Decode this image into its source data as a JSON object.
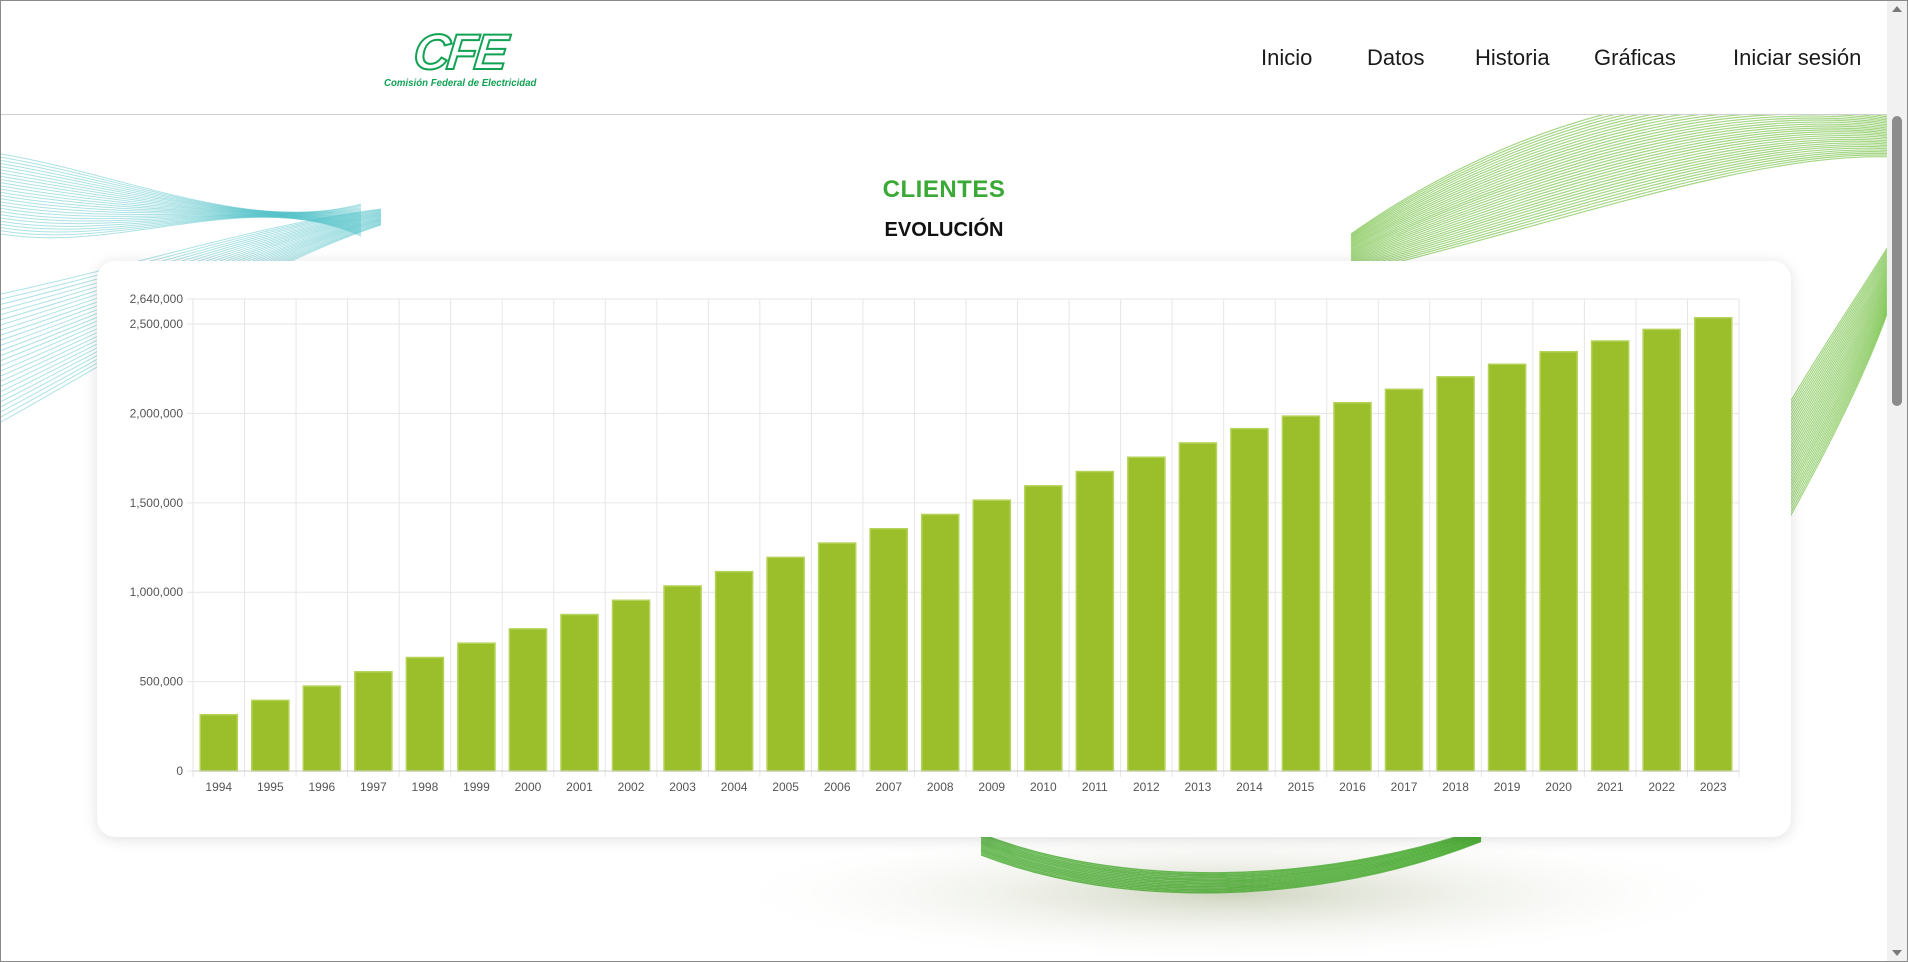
{
  "logo": {
    "mark": "CFE",
    "subtitle": "Comisión Federal de Electricidad"
  },
  "nav": {
    "items": [
      "Inicio",
      "Datos",
      "Historia",
      "Gráficas",
      "Iniciar sesión"
    ]
  },
  "page": {
    "title": "CLIENTES",
    "subtitle": "EVOLUCIÓN"
  },
  "colors": {
    "accent": "#3aa935",
    "bar": "#9bbf2a",
    "bar_border": "#b5d35a"
  },
  "chart_data": {
    "type": "bar",
    "categories": [
      "1994",
      "1995",
      "1996",
      "1997",
      "1998",
      "1999",
      "2000",
      "2001",
      "2002",
      "2003",
      "2004",
      "2005",
      "2006",
      "2007",
      "2008",
      "2009",
      "2010",
      "2011",
      "2012",
      "2013",
      "2014",
      "2015",
      "2016",
      "2017",
      "2018",
      "2019",
      "2020",
      "2021",
      "2022",
      "2023"
    ],
    "values": [
      315000,
      395000,
      475000,
      555000,
      635000,
      715000,
      795000,
      875000,
      955000,
      1035000,
      1115000,
      1195000,
      1275000,
      1355000,
      1435000,
      1515000,
      1595000,
      1675000,
      1755000,
      1835000,
      1915000,
      1985000,
      2060000,
      2135000,
      2205000,
      2275000,
      2345000,
      2405000,
      2470000,
      2535000
    ],
    "ylim": [
      0,
      2640000
    ],
    "yticks": [
      "0",
      "500,000",
      "1,000,000",
      "1,500,000",
      "2,000,000",
      "2,500,000",
      "2,640,000"
    ],
    "ytick_values": [
      0,
      500000,
      1000000,
      1500000,
      2000000,
      2500000,
      2640000
    ],
    "grid": true,
    "legend": "none"
  }
}
